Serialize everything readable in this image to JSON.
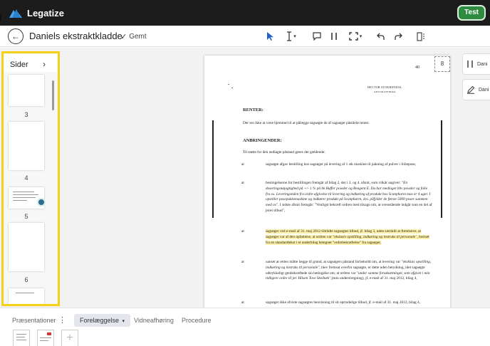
{
  "app": {
    "name": "Legatize",
    "user": "Test"
  },
  "document": {
    "title": "Daniels ekstraktkladde",
    "saved_status": "Gemt"
  },
  "toolbar": {
    "tools": [
      "cursor-tool",
      "text-select-tool",
      "comment-tool",
      "columns-tool",
      "region-select-tool",
      "undo",
      "redo",
      "layout-tool"
    ]
  },
  "sidebar": {
    "title": "Sider",
    "pages": [
      "3",
      "4",
      "5",
      "6"
    ]
  },
  "page": {
    "number_box": "8",
    "page_number": "40",
    "header_name": "HECTOR  STOKBENDAL",
    "header_sub": "ADVOKATFIRMA",
    "renter_heading": "RENTER:",
    "renter_text": "Der ses ikke at være hjemmel til at pålægge sagsøgte de af sagsøger påstårde renter.",
    "anbringender_heading": "ANBRINGENDER:",
    "intro": "Til støtte for den nedlagte påstand gøres det gældende:",
    "at_label": "at",
    "item1": "sagsøgte afgav bestilling hos sagsøger på levering af 1 stk maskine til pakning af pulver i foliepose,",
    "item2_normal": "bestingelserne for bestillingen fremgår af bilag 2, der i 3. og 4. afsnit, som vilkår angiver: ",
    "item2_italic": "\"En doseringsnøjagtighed på +/- 1 % på bk Buffer powder og Reagent E. Du har medlaget hhv powder og folie fra os. Leveringstiden fra ordre afgivelse til levering og indkøring af produkt hos Scanpharm mas er 4 uger. I opstiller posepakkemaskine og indkører produkt på Scanpharm, dvs. påfylder de første 5000 poser sammen med os\".",
    "item2_tail": " I sidste afsnit fremgår: \"Venligst bekræft ordren med tilsagn om, at ovenstående indgår som en del af jeres tilbud\",",
    "item3_highlight_a": "sagsøger ved e-mail af 31. maj 2012 tiltrådte sagsøgtes tilbud, jf. bilag 3, uden særskilt at fremhæve, at sagsøger var af den opfattelse, at ordren var ",
    "item3_highlight_italic": "\"ekslusiv opstilling, indkøring og instruks til personale\"",
    "item3_highlight_b": ", bortset fra en standardtekst i et underbilag betegnet \"ordrebekræftelse\" fra sagsøger,",
    "item4": "uanset at retten måtte lægge til grund, at sagsøgers påstand forbeholdt om, at levering var ",
    "item4_italic": "\"ekskluis opstilling, indkøring og instruks til personale\"",
    "item4_tail": ", blev fremsat overfor sagsøgte, er dette uden betydning, idet sagsøgte udtrykkeligt genbekræftede sin betingelse om, at ordren var ",
    "item4_italic2": "\"under samme forudsætninger, som afgivet i min tidligere ordre til jer. Hilsen Tove Skeibæk\"",
    "item4_end": ",(min understregning), jf. e-mail af 31. maj 2012, bilag 4,",
    "item5": "sagsøger ikke afviste sagsøgtes henvisning til sit oprindelige tilbud, jf. e-mail af 31. maj 2012, bilag 4,"
  },
  "right_panel": {
    "cards": [
      "Dani",
      "Dani"
    ]
  },
  "bottom": {
    "tabs": [
      "Præsentationer",
      "Forelæggelse",
      "Vidneafhøring",
      "Procedure"
    ],
    "active_tab": "Forelæggelse",
    "more_label": "⋮",
    "add_label": "+"
  },
  "colors": {
    "highlight": "#fdf2a8",
    "accent": "#2e8b3f",
    "sidebar_border": "#f5d016"
  }
}
